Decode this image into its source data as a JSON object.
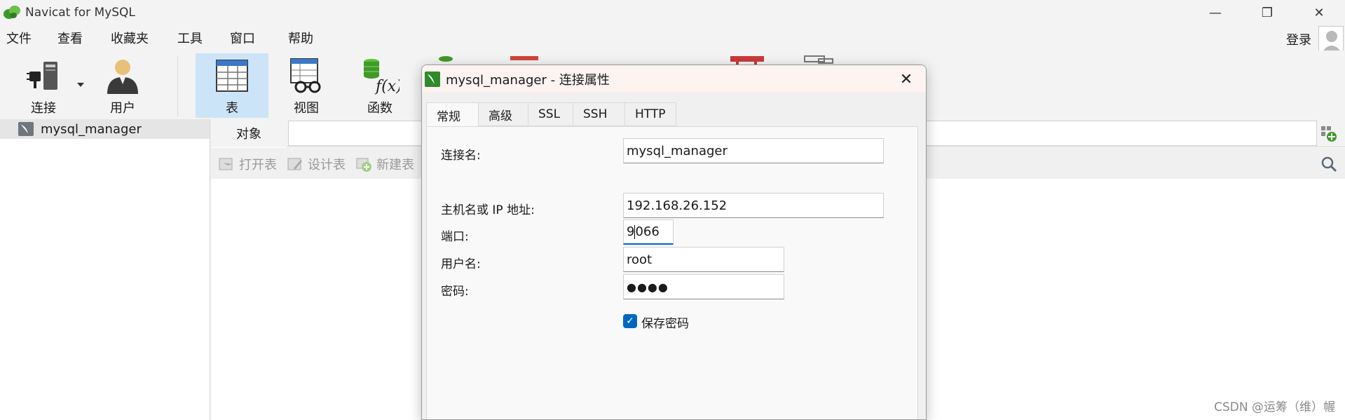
{
  "window": {
    "title": "Navicat for MySQL",
    "controls": {
      "minimize": "—",
      "restore": "❐",
      "close": "✕"
    }
  },
  "menu": {
    "items": [
      "文件",
      "查看",
      "收藏夹",
      "工具",
      "窗口",
      "帮助"
    ],
    "login_label": "登录"
  },
  "toolbar": {
    "buttons": [
      {
        "label": "连接",
        "icon": "connection-icon"
      },
      {
        "label": "用户",
        "icon": "user-icon"
      },
      {
        "label": "表",
        "icon": "table-icon",
        "active": true
      },
      {
        "label": "视图",
        "icon": "view-icon"
      },
      {
        "label": "函数",
        "icon": "function-icon"
      }
    ]
  },
  "sidebar": {
    "connections": [
      {
        "label": "mysql_manager"
      }
    ]
  },
  "main": {
    "tab_label": "对象",
    "object_actions": [
      "打开表",
      "设计表",
      "新建表"
    ]
  },
  "dialog": {
    "title": "mysql_manager - 连接属性",
    "tabs": [
      "常规",
      "高级",
      "SSL",
      "SSH",
      "HTTP"
    ],
    "active_tab": "常规",
    "fields": {
      "conn_name_label": "连接名:",
      "conn_name_value": "mysql_manager",
      "host_label": "主机名或 IP 地址:",
      "host_value": "192.168.26.152",
      "port_label": "端口:",
      "port_value_before_caret": "9",
      "port_value_after_caret": "066",
      "user_label": "用户名:",
      "user_value": "root",
      "password_label": "密码:",
      "password_value": "●●●●",
      "save_password_label": "保存密码",
      "save_password_checked": true
    }
  },
  "watermark": "CSDN @运筹（维）幄",
  "colors": {
    "accent": "#0067c0",
    "active_toolbar": "#cce4f7",
    "dialog_title_bg": "#fdf3f1"
  }
}
